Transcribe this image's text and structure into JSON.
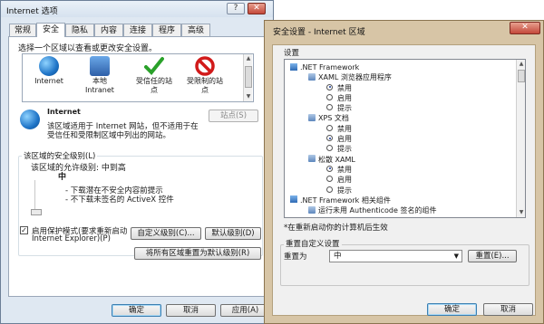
{
  "left_window": {
    "title": "Internet 选项",
    "caption_help": "?",
    "caption_close": "✕",
    "tabs": [
      "常规",
      "安全",
      "隐私",
      "内容",
      "连接",
      "程序",
      "高级"
    ],
    "instruction": "选择一个区域以查看或更改安全设置。",
    "zones": [
      {
        "label": "Internet",
        "icon": "globe-icon"
      },
      {
        "label": "本地\nIntranet",
        "icon": "intranet-icon"
      },
      {
        "label": "受信任的站\n点",
        "icon": "check-icon"
      },
      {
        "label": "受限制的站\n点",
        "icon": "restricted-icon"
      }
    ],
    "zone_title": "Internet",
    "zone_desc_1": "该区域适用于 Internet 网站，但不适用于在",
    "zone_desc_2": "受信任和受限制区域中列出的网站。",
    "sites_button": "站点(S)",
    "security_level_label": "该区域的安全级别(L)",
    "allowed_levels": "该区域的允许级别: 中到高",
    "level_name": "中",
    "level_bullet_1": "- 下载潜在不安全内容前提示",
    "level_bullet_2": "- 不下载未签名的 ActiveX 控件",
    "protected_mode_1": "启用保护模式(要求重新启动",
    "protected_mode_2": "Internet Explorer)(P)",
    "protected_mode_checked": true,
    "custom_level_button": "自定义级别(C)...",
    "default_level_button": "默认级别(D)",
    "reset_all_button": "将所有区域重置为默认级别(R)",
    "ok_button": "确定",
    "cancel_button": "取消",
    "apply_button": "应用(A)"
  },
  "right_window": {
    "title": "安全设置 - Internet 区域",
    "caption_close": "✕",
    "settings_label": "设置",
    "tree": [
      {
        "type": "group",
        "text": ".NET Framework",
        "indent": 0
      },
      {
        "type": "item",
        "text": "XAML 浏览器应用程序",
        "indent": 1
      },
      {
        "type": "radio",
        "text": "禁用",
        "checked": true,
        "indent": 2
      },
      {
        "type": "radio",
        "text": "启用",
        "checked": false,
        "indent": 2
      },
      {
        "type": "radio",
        "text": "提示",
        "checked": false,
        "indent": 2
      },
      {
        "type": "item",
        "text": "XPS 文档",
        "indent": 1
      },
      {
        "type": "radio",
        "text": "禁用",
        "checked": false,
        "indent": 2
      },
      {
        "type": "radio",
        "text": "启用",
        "checked": true,
        "indent": 2
      },
      {
        "type": "radio",
        "text": "提示",
        "checked": false,
        "indent": 2
      },
      {
        "type": "item",
        "text": "松散 XAML",
        "indent": 1
      },
      {
        "type": "radio",
        "text": "禁用",
        "checked": true,
        "indent": 2
      },
      {
        "type": "radio",
        "text": "启用",
        "checked": false,
        "indent": 2
      },
      {
        "type": "radio",
        "text": "提示",
        "checked": false,
        "indent": 2
      },
      {
        "type": "group",
        "text": ".NET Framework 相关组件",
        "indent": 0
      },
      {
        "type": "item",
        "text": "运行未用 Authenticode 签名的组件",
        "indent": 1
      }
    ],
    "restart_note": "*在重新启动你的计算机后生效",
    "reset_group_label": "重置自定义设置",
    "reset_to_label": "重置为",
    "reset_select_value": "中",
    "reset_button": "重置(E)...",
    "ok_button": "确定",
    "cancel_button": "取消"
  }
}
